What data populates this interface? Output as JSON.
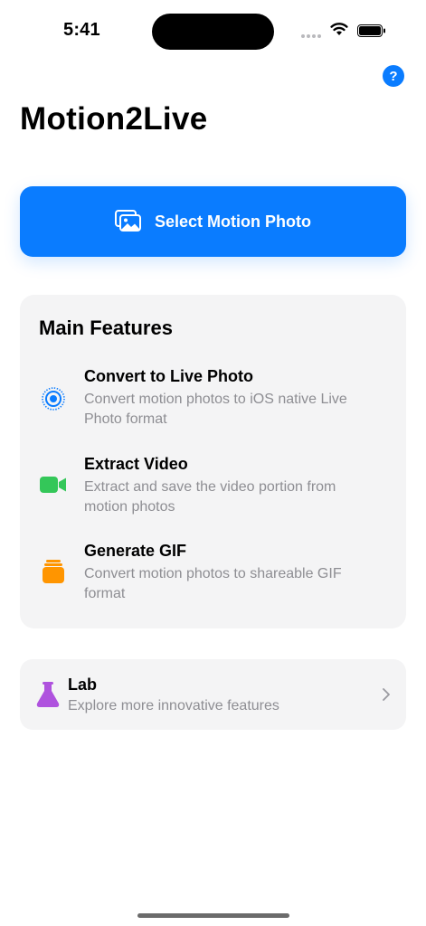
{
  "status_bar": {
    "time": "5:41"
  },
  "header": {
    "help_label": "?",
    "title": "Motion2Live"
  },
  "select_button": {
    "label": "Select Motion Photo",
    "icon": "photos-icon"
  },
  "features": {
    "title": "Main Features",
    "items": [
      {
        "title": "Convert to Live Photo",
        "description": "Convert motion photos to iOS native Live Photo format",
        "icon": "live-photo-icon",
        "color": "#0a7cff"
      },
      {
        "title": "Extract Video",
        "description": "Extract and save the video portion from motion photos",
        "icon": "video-camera-icon",
        "color": "#34c759"
      },
      {
        "title": "Generate GIF",
        "description": "Convert motion photos to shareable GIF format",
        "icon": "stack-icon",
        "color": "#ff9500"
      }
    ]
  },
  "lab": {
    "title": "Lab",
    "description": "Explore more innovative features",
    "icon": "flask-icon",
    "color": "#af52de"
  },
  "colors": {
    "accent": "#0a7cff",
    "card_background": "#f4f4f5",
    "secondary_text": "#8e8e93"
  }
}
